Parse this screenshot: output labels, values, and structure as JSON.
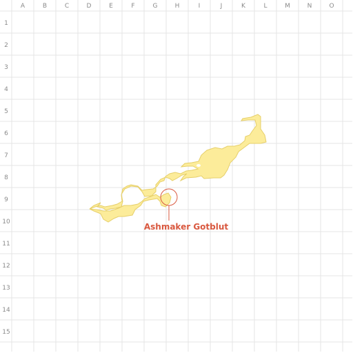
{
  "grid": {
    "columns": [
      "A",
      "B",
      "C",
      "D",
      "E",
      "F",
      "G",
      "H",
      "I",
      "J",
      "K",
      "L",
      "M",
      "N",
      "O"
    ],
    "rows": [
      "1",
      "2",
      "3",
      "4",
      "5",
      "6",
      "7",
      "8",
      "9",
      "10",
      "11",
      "12",
      "13",
      "14",
      "15"
    ]
  },
  "colors": {
    "grid_line": "#e4e4e4",
    "label": "#8a8a8a",
    "region_fill": "#fcec9a",
    "region_stroke": "#e6cf6a",
    "marker": "#d9583f"
  },
  "marker": {
    "label": "Ashmaker Gotblut",
    "icon": "map-pin-circle-icon"
  }
}
